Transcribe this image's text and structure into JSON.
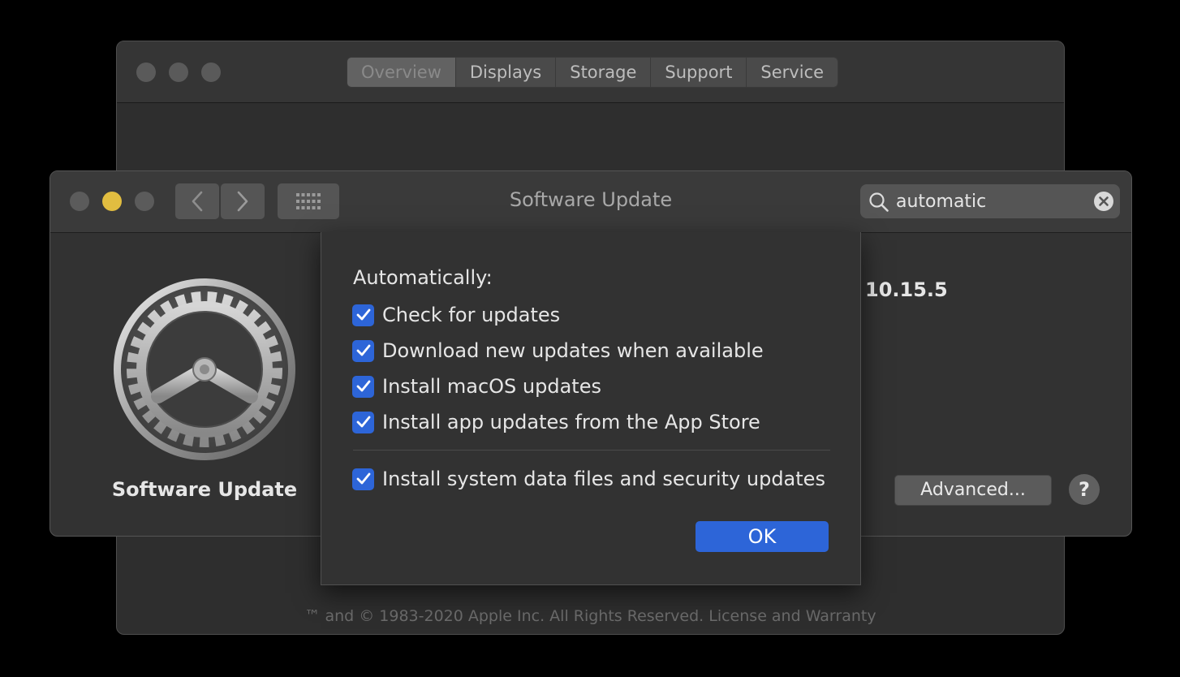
{
  "about_window": {
    "tabs": [
      {
        "label": "Overview",
        "active": true
      },
      {
        "label": "Displays",
        "active": false
      },
      {
        "label": "Storage",
        "active": false
      },
      {
        "label": "Support",
        "active": false
      },
      {
        "label": "Service",
        "active": false
      }
    ],
    "copyright": "™ and © 1983-2020 Apple Inc. All Rights Reserved. License and Warranty"
  },
  "software_update_window": {
    "title": "Software Update",
    "search": {
      "value": "automatic"
    },
    "app_label": "Software Update",
    "version": "10.15.5",
    "advanced_label": "Advanced...",
    "help_label": "?"
  },
  "sheet": {
    "heading": "Automatically:",
    "options": [
      {
        "label": "Check for updates",
        "checked": true
      },
      {
        "label": "Download new updates when available",
        "checked": true
      },
      {
        "label": "Install macOS updates",
        "checked": true
      },
      {
        "label": "Install app updates from the App Store",
        "checked": true
      },
      {
        "label": "Install system data files and security updates",
        "checked": true
      }
    ],
    "ok_label": "OK"
  },
  "colors": {
    "accent_blue": "#2d65d8",
    "minimize_yellow": "#e1bd40",
    "window_background": "#323232"
  },
  "icons": [
    "search-icon",
    "clear-search-icon",
    "chevron-left-icon",
    "chevron-right-icon",
    "grid-icon",
    "gear-icon",
    "checkmark-icon"
  ]
}
